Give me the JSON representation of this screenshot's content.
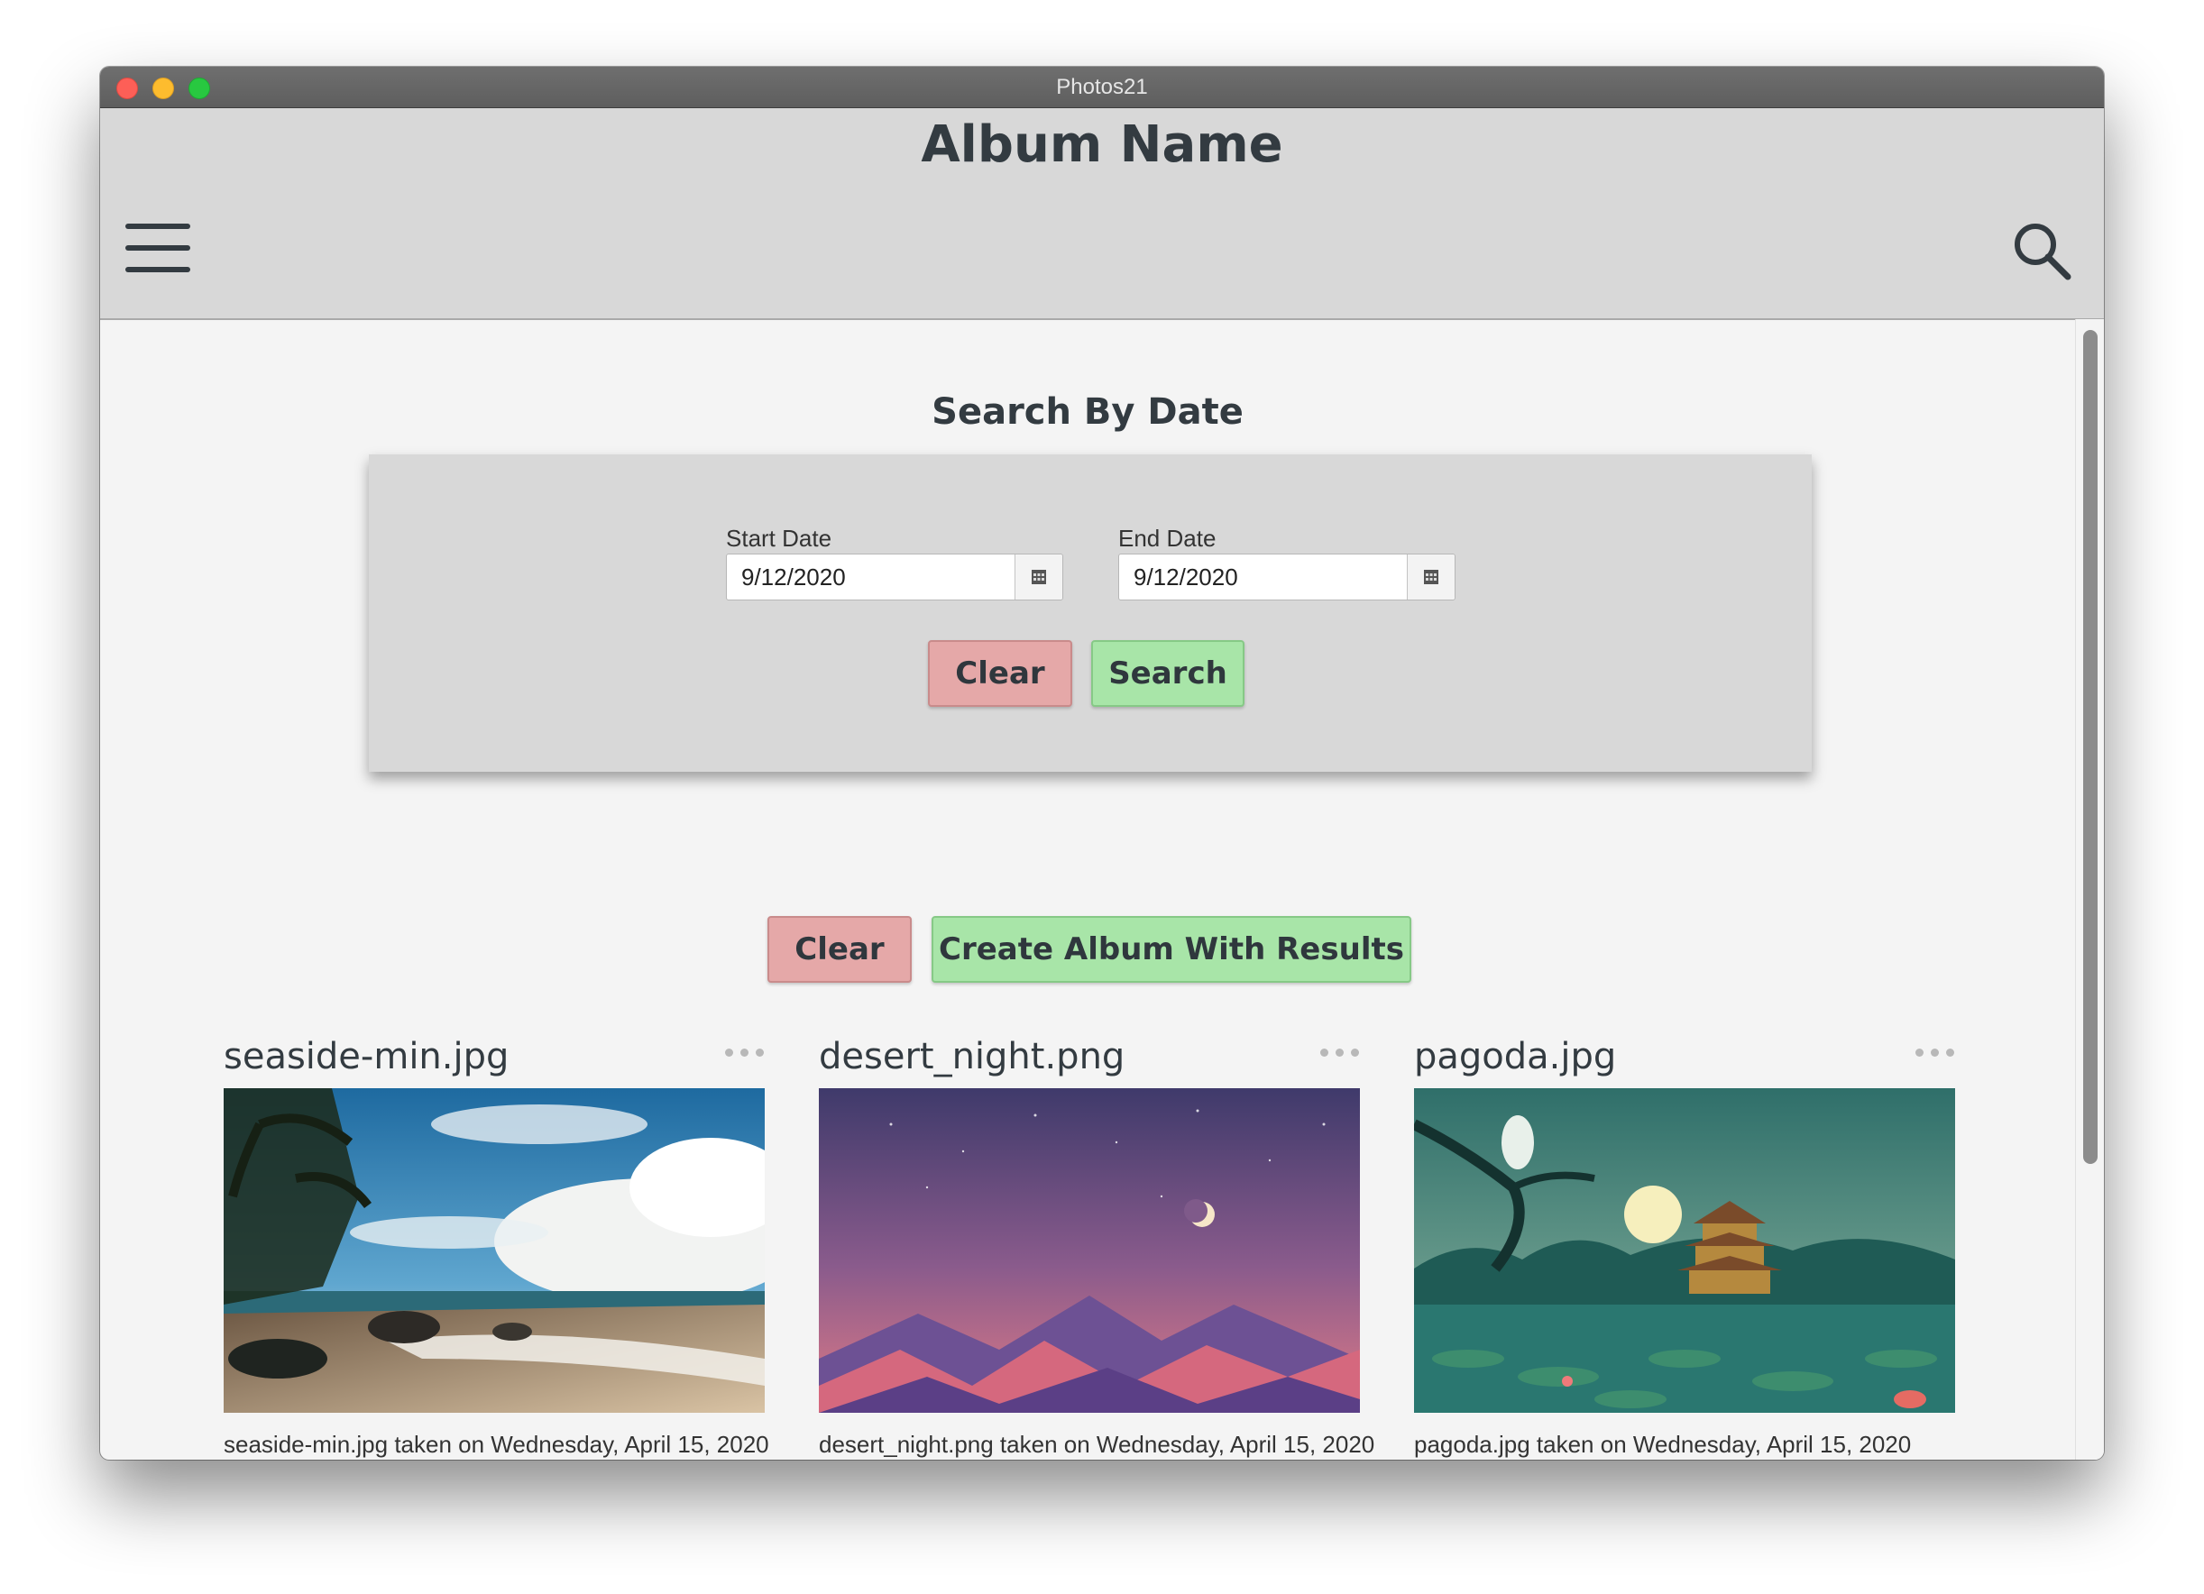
{
  "window": {
    "title": "Photos21"
  },
  "header": {
    "title": "Album Name"
  },
  "search_by_date": {
    "title": "Search By Date",
    "start_date": {
      "label": "Start Date",
      "value": "9/12/2020"
    },
    "end_date": {
      "label": "End Date",
      "value": "9/12/2020"
    },
    "clear_label": "Clear",
    "search_label": "Search"
  },
  "results": {
    "clear_label": "Clear",
    "create_album_label": "Create Album With Results"
  },
  "photos": [
    {
      "name": "seaside-min.jpg",
      "caption": "seaside-min.jpg taken on Wednesday, April 15, 2020"
    },
    {
      "name": "desert_night.png",
      "caption": "desert_night.png taken on Wednesday, April 15, 2020"
    },
    {
      "name": "pagoda.jpg",
      "caption": "pagoda.jpg taken on Wednesday, April 15, 2020"
    }
  ],
  "icons": {
    "menu": "hamburger-menu-icon",
    "search": "search-icon",
    "calendar": "calendar-icon",
    "more": "more-options-icon"
  },
  "colors": {
    "header_bg": "#d8d8d8",
    "content_bg": "#f4f4f4",
    "clear_button": "#e5a8a8",
    "confirm_button": "#a8e5a8",
    "text_dark": "#333b41"
  }
}
